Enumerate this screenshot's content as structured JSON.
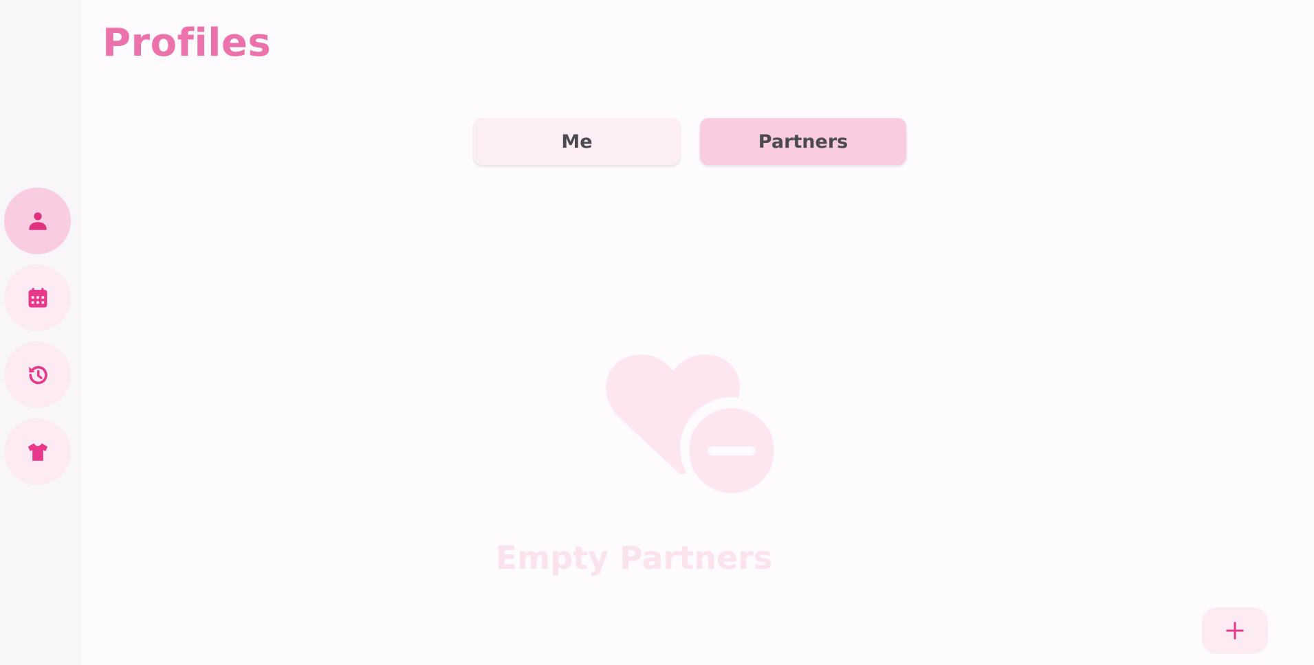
{
  "header": {
    "title": "Profiles"
  },
  "tabs": [
    {
      "label": "Me",
      "selected": false
    },
    {
      "label": "Partners",
      "selected": true
    }
  ],
  "navigation_rail": {
    "items": [
      {
        "icon": "person-icon",
        "selected": true
      },
      {
        "icon": "calendar-icon",
        "selected": false
      },
      {
        "icon": "history-icon",
        "selected": false
      },
      {
        "icon": "shirt-icon",
        "selected": false
      }
    ]
  },
  "empty_state": {
    "icon": "heart-remove-icon",
    "message": "Empty Partners"
  },
  "fab": {
    "icon": "plus-icon"
  },
  "colors": {
    "accent": "#e8388a",
    "accent_light": "#ec72ac",
    "selected_bg": "#f9cce1",
    "unselected_bg": "#fdebf3",
    "rail_bg": "#f8f6f8",
    "page_bg": "#fdfbfd",
    "empty_state": "#fbe3ee"
  }
}
